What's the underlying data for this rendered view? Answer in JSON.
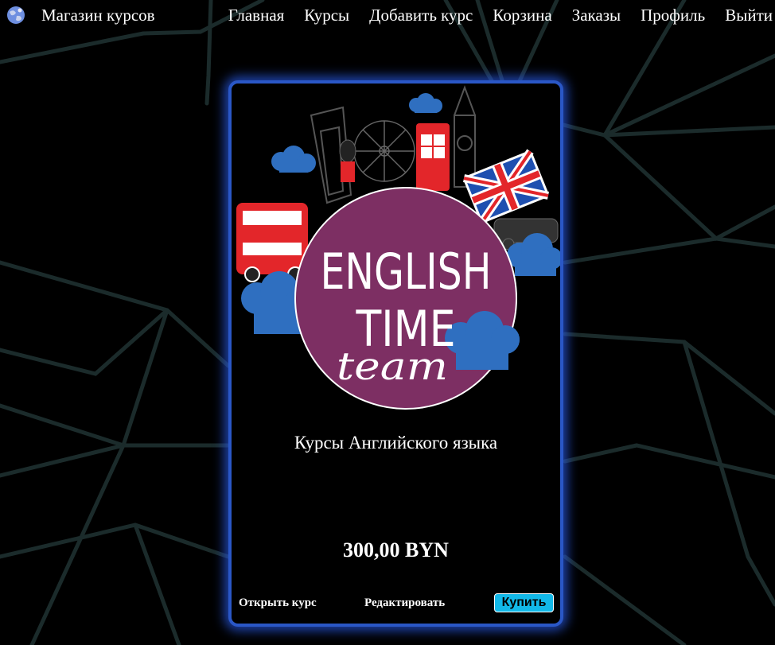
{
  "navbar": {
    "brand": "Магазин курсов",
    "links": [
      "Главная",
      "Курсы",
      "Добавить курс",
      "Корзина",
      "Заказы",
      "Профиль",
      "Выйти"
    ]
  },
  "course": {
    "image_text": {
      "line1": "ENGLISH",
      "line2": "TIME",
      "line3": "team"
    },
    "title": "Курсы Английского языка",
    "price": "300,00 BYN",
    "open_label": "Открыть курс",
    "edit_label": "Редактировать",
    "buy_label": "Купить"
  },
  "colors": {
    "background": "#000000",
    "card_border": "#2a57c6",
    "buy_button": "#12b8e8",
    "logo_circle": "#7d2f63",
    "clouds": "#2f6fc0",
    "bus_red": "#e3262a",
    "bg_lines": "#1a2a2a"
  }
}
